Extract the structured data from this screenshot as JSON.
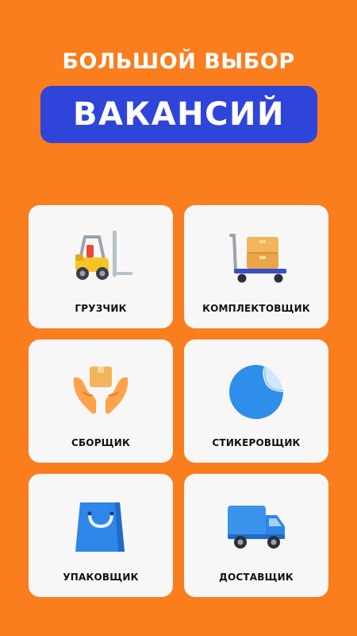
{
  "header": {
    "line1": "БОЛЬШОЙ ВЫБОР",
    "highlight": "ВАКАНСИЙ"
  },
  "colors": {
    "background": "#FA7D1E",
    "highlight_bg": "#2F45D9",
    "card_bg": "#F7F7F7"
  },
  "jobs": [
    {
      "label": "ГРУЗЧИК",
      "icon": "forklift-icon"
    },
    {
      "label": "КОМПЛЕКТОВЩИК",
      "icon": "cart-with-boxes-icon"
    },
    {
      "label": "СБОРЩИК",
      "icon": "hands-holding-box-icon"
    },
    {
      "label": "СТИКЕРОВЩИК",
      "icon": "sticker-icon"
    },
    {
      "label": "УПАКОВЩИК",
      "icon": "shopping-bag-icon"
    },
    {
      "label": "ДОСТАВЩИК",
      "icon": "delivery-truck-icon"
    }
  ]
}
